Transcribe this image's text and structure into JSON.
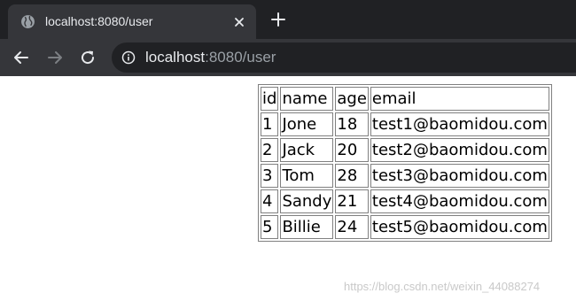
{
  "browser": {
    "tab_title": "localhost:8080/user",
    "url_host": "localhost",
    "url_path": ":8080/user",
    "icons": {
      "favicon": "globe-icon",
      "close": "close-icon",
      "new_tab": "plus-icon",
      "back": "arrow-left-icon",
      "forward": "arrow-right-icon",
      "reload": "reload-icon",
      "site_info": "info-icon"
    },
    "colors": {
      "tabstrip": "#202124",
      "toolbar": "#35363a",
      "text": "#e8eaed",
      "dim_text": "#9aa0a6"
    }
  },
  "table": {
    "columns": [
      "id",
      "name",
      "age",
      "email"
    ],
    "rows": [
      [
        "1",
        "Jone",
        "18",
        "test1@baomidou.com"
      ],
      [
        "2",
        "Jack",
        "20",
        "test2@baomidou.com"
      ],
      [
        "3",
        "Tom",
        "28",
        "test3@baomidou.com"
      ],
      [
        "4",
        "Sandy",
        "21",
        "test4@baomidou.com"
      ],
      [
        "5",
        "Billie",
        "24",
        "test5@baomidou.com"
      ]
    ]
  },
  "watermark": "https://blog.csdn.net/weixin_44088274"
}
